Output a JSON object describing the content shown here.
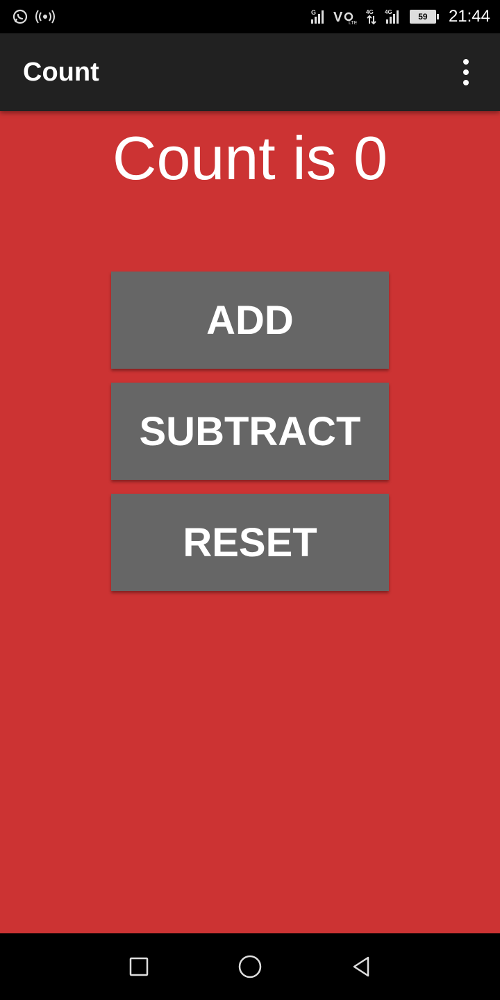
{
  "status_bar": {
    "left_icons": [
      "whatsapp-icon",
      "hotspot-icon"
    ],
    "right_icons": [
      "signal-g-icon",
      "volte-icon",
      "signal-4g-icon",
      "signal-4g-2-icon"
    ],
    "volte_text": "V",
    "battery_level": "59",
    "time": "21:44"
  },
  "app_bar": {
    "title": "Count",
    "menu_icon": "overflow-menu-icon"
  },
  "main": {
    "count_text": "Count is 0",
    "buttons": {
      "add": "ADD",
      "subtract": "SUBTRACT",
      "reset": "RESET"
    }
  },
  "nav_bar": {
    "icons": [
      "recents-icon",
      "home-icon",
      "back-icon"
    ]
  },
  "colors": {
    "background": "#cc3333",
    "app_bar": "#212121",
    "button": "#666666",
    "text": "#ffffff"
  }
}
